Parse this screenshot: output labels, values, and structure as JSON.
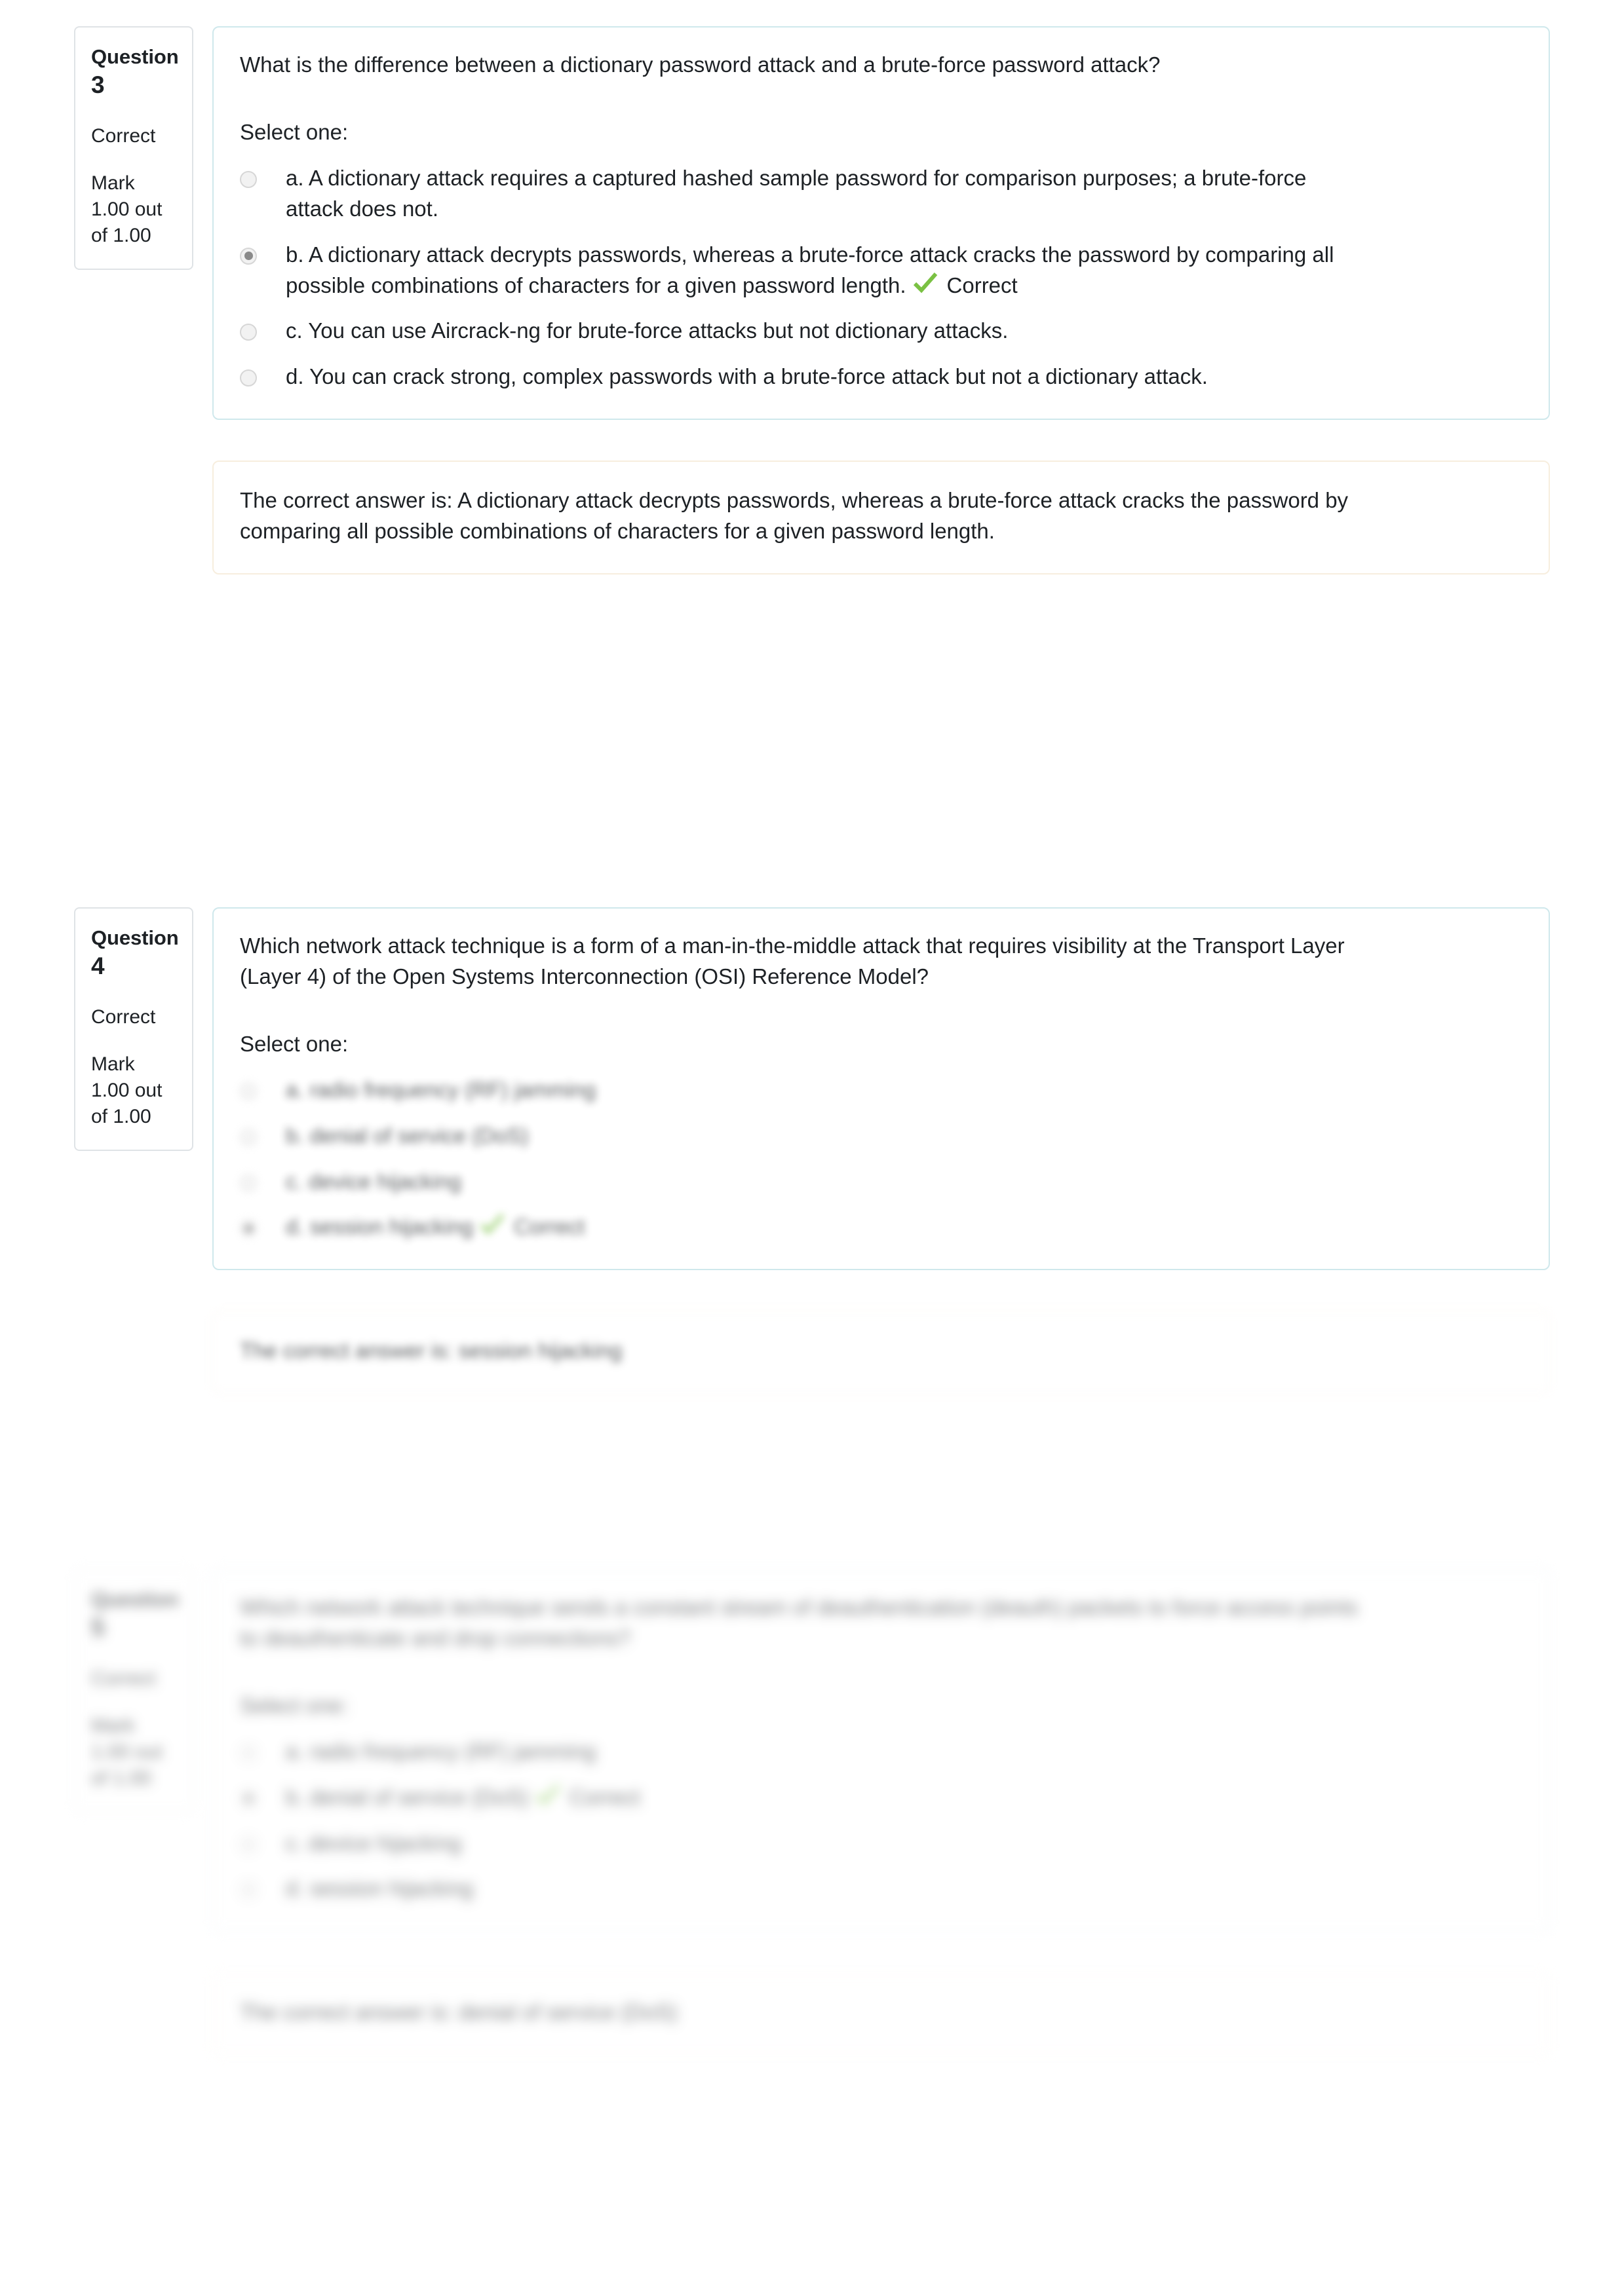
{
  "page": {
    "background": "#ffffff",
    "card_border_color": "#cfe8ec",
    "info_border_color": "#dfe3e6",
    "feedback_border_color": "#f7eede",
    "correct_tick_color": "#7ac143"
  },
  "labels": {
    "question_word": "Question",
    "select_one": "Select one:",
    "correct_marker": "Correct"
  },
  "questions": [
    {
      "number": "3",
      "info": {
        "title_word": "Question",
        "number": "3",
        "state": "Correct",
        "grade": "Mark 1.00 out of 1.00"
      },
      "text": "What is the difference between a dictionary password attack and a brute-force password attack?",
      "select_one": "Select one:",
      "answers": [
        {
          "label": "a. A dictionary attack requires a captured hashed sample password for comparison purposes; a brute-force attack does not.",
          "selected": false,
          "correct_flag": ""
        },
        {
          "label": "b. A dictionary attack decrypts passwords, whereas a brute-force attack cracks the password by comparing all possible combinations of characters for a given password length.",
          "selected": true,
          "correct_flag": "Correct"
        },
        {
          "label": "c. You can use Aircrack-ng for brute-force attacks but not dictionary attacks.",
          "selected": false,
          "correct_flag": ""
        },
        {
          "label": "d. You can crack strong, complex passwords with a brute-force attack but not a dictionary attack.",
          "selected": false,
          "correct_flag": ""
        }
      ],
      "feedback": "The correct answer is: A dictionary attack decrypts passwords, whereas a brute-force attack cracks the password by comparing all possible combinations of characters for a given password length."
    },
    {
      "number": "4",
      "info": {
        "title_word": "Question",
        "number": "4",
        "state": "Correct",
        "grade": "Mark 1.00 out of 1.00"
      },
      "text": "Which network attack technique is a form of a man-in-the-middle attack that requires visibility at the Transport Layer (Layer 4) of the Open Systems Interconnection (OSI) Reference Model?",
      "select_one": "Select one:",
      "answers": [
        {
          "label": "a. radio frequency (RF) jamming",
          "selected": false,
          "correct_flag": ""
        },
        {
          "label": "b. denial of service (DoS)",
          "selected": false,
          "correct_flag": ""
        },
        {
          "label": "c. device hijacking",
          "selected": false,
          "correct_flag": ""
        },
        {
          "label": "d. session hijacking",
          "selected": true,
          "correct_flag": "Correct"
        }
      ],
      "feedback": "The correct answer is: session hijacking"
    },
    {
      "number": "5",
      "info": {
        "title_word": "Question",
        "number": "5",
        "state": "Correct",
        "grade": "Mark 1.00 out of 1.00"
      },
      "text": "Which network attack technique sends a constant stream of deauthentication (deauth) packets to force access points to deauthenticate and drop connections?",
      "select_one": "Select one:",
      "answers": [
        {
          "label": "a. radio frequency (RF) jamming",
          "selected": false,
          "correct_flag": ""
        },
        {
          "label": "b. denial of service (DoS)",
          "selected": true,
          "correct_flag": "Correct"
        },
        {
          "label": "c. device hijacking",
          "selected": false,
          "correct_flag": ""
        },
        {
          "label": "d. session hijacking",
          "selected": false,
          "correct_flag": ""
        }
      ],
      "feedback": "The correct answer is: denial of service (DoS)"
    }
  ]
}
